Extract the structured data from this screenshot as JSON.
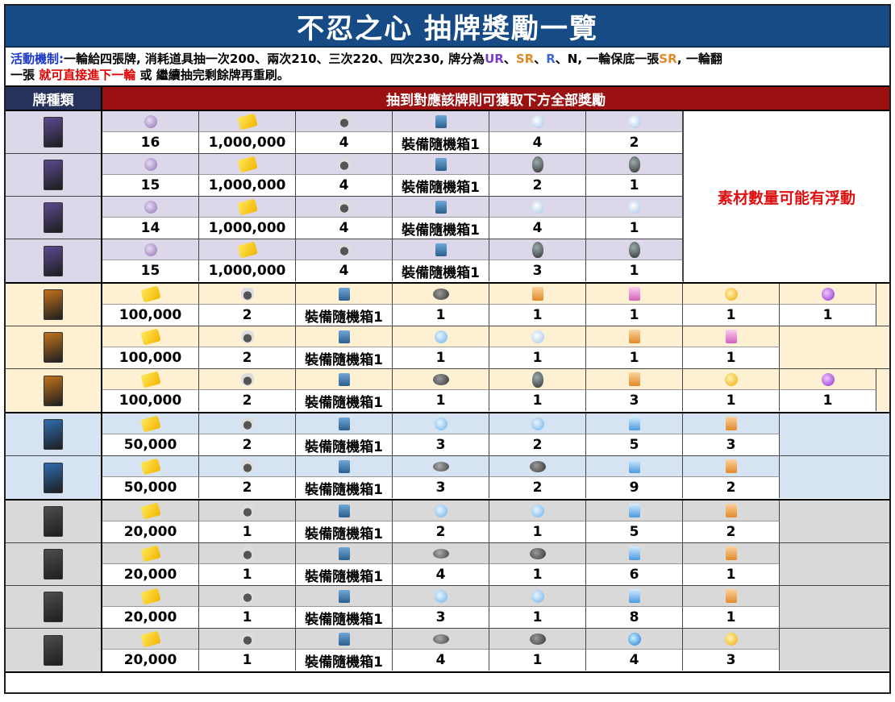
{
  "title": "不忍之心 抽牌獎勵一覽",
  "description": {
    "label": "活動機制:",
    "line1": "一輪給四張牌, 消耗道具抽一次200、兩次210、三次220、四次230, 牌分為",
    "ur": "UR",
    "sep1": "、",
    "sr": "SR",
    "sep2": "、",
    "r": "R",
    "line2": "、N, 一輪保底一張",
    "sr2": "SR",
    "line3": ", 一輪翻",
    "line4": "一張 ",
    "highlight": "就可直接進下一輪",
    "line5": " 或 繼續抽完剩餘牌再重刷。"
  },
  "header": {
    "left": "牌種類",
    "right": "抽到對應該牌則可獲取下方全部獎勵"
  },
  "side_note": "素材數量可能有浮動",
  "colors": {
    "ur_bg": "#ddd7ea",
    "sr_bg": "#fdf0d3",
    "r_bg": "#d6e3f2",
    "n_bg": "#d9d9d9"
  },
  "groups": [
    {
      "tier": "UR",
      "rows": [
        {
          "card": "UR-1",
          "icons": [
            "gem-icon",
            "money-icon",
            "coffee-icon",
            "box-icon",
            "crystal-icon",
            "crystal-icon"
          ],
          "values": [
            "16",
            "1,000,000",
            "4",
            "裝備隨機箱1",
            "4",
            "2"
          ]
        },
        {
          "card": "UR-2",
          "icons": [
            "gem-icon",
            "money-icon",
            "coffee-icon",
            "box-icon",
            "stone-icon",
            "stone-icon"
          ],
          "values": [
            "15",
            "1,000,000",
            "4",
            "裝備隨機箱1",
            "2",
            "1"
          ]
        },
        {
          "card": "UR-3",
          "icons": [
            "gem-icon",
            "money-icon",
            "coffee-icon",
            "box-icon",
            "crystal-icon",
            "crystal-icon"
          ],
          "values": [
            "14",
            "1,000,000",
            "4",
            "裝備隨機箱1",
            "4",
            "1"
          ]
        },
        {
          "card": "UR-4",
          "icons": [
            "gem-icon",
            "money-icon",
            "coffee-icon",
            "box-icon",
            "stone-icon",
            "stone-icon"
          ],
          "values": [
            "15",
            "1,000,000",
            "4",
            "裝備隨機箱1",
            "3",
            "1"
          ]
        }
      ]
    },
    {
      "tier": "SR",
      "rows": [
        {
          "card": "SR-1",
          "icons": [
            "money-icon",
            "coffee-icon",
            "box-icon",
            "fish-icon",
            "note-icon",
            "pnote-icon",
            "gold-icon",
            "purple-icon"
          ],
          "values": [
            "100,000",
            "2",
            "裝備隨機箱1",
            "1",
            "1",
            "1",
            "1",
            "1"
          ]
        },
        {
          "card": "SR-2",
          "icons": [
            "money-icon",
            "coffee-icon",
            "box-icon",
            "drop-icon",
            "crystal-icon",
            "note-icon",
            "pnote-icon"
          ],
          "values": [
            "100,000",
            "2",
            "裝備隨機箱1",
            "1",
            "1",
            "1",
            "1"
          ]
        },
        {
          "card": "SR-3",
          "icons": [
            "money-icon",
            "coffee-icon",
            "box-icon",
            "fish-icon",
            "stone-icon",
            "note-icon",
            "gold-icon",
            "purple-icon"
          ],
          "values": [
            "100,000",
            "2",
            "裝備隨機箱1",
            "1",
            "1",
            "3",
            "1",
            "1"
          ]
        }
      ]
    },
    {
      "tier": "R",
      "rows": [
        {
          "card": "R-1",
          "icons": [
            "money-icon",
            "coffee-icon",
            "box-icon",
            "drop-icon",
            "drop-icon",
            "bnote-icon",
            "note-icon"
          ],
          "values": [
            "50,000",
            "2",
            "裝備隨機箱1",
            "3",
            "2",
            "5",
            "3"
          ]
        },
        {
          "card": "R-2",
          "icons": [
            "money-icon",
            "coffee-icon",
            "box-icon",
            "ore-icon",
            "fish-icon",
            "bnote-icon",
            "note-icon"
          ],
          "values": [
            "50,000",
            "2",
            "裝備隨機箱1",
            "3",
            "2",
            "9",
            "2"
          ]
        }
      ]
    },
    {
      "tier": "N",
      "rows": [
        {
          "card": "N-1",
          "icons": [
            "money-icon",
            "coffee-icon",
            "box-icon",
            "drop-icon",
            "drop-icon",
            "bnote-icon",
            "note-icon"
          ],
          "values": [
            "20,000",
            "1",
            "裝備隨機箱1",
            "2",
            "1",
            "5",
            "2"
          ]
        },
        {
          "card": "N-2",
          "icons": [
            "money-icon",
            "coffee-icon",
            "box-icon",
            "ore-icon",
            "fish-icon",
            "bnote-icon",
            "note-icon"
          ],
          "values": [
            "20,000",
            "1",
            "裝備隨機箱1",
            "4",
            "1",
            "6",
            "1"
          ]
        },
        {
          "card": "N-3",
          "icons": [
            "money-icon",
            "coffee-icon",
            "box-icon",
            "drop-icon",
            "drop-icon",
            "bnote-icon",
            "note-icon"
          ],
          "values": [
            "20,000",
            "1",
            "裝備隨機箱1",
            "3",
            "1",
            "8",
            "1"
          ]
        },
        {
          "card": "N-4",
          "icons": [
            "money-icon",
            "coffee-icon",
            "box-icon",
            "ore-icon",
            "fish-icon",
            "bluejewel-icon",
            "gold-icon"
          ],
          "values": [
            "20,000",
            "1",
            "裝備隨機箱1",
            "4",
            "1",
            "4",
            "3"
          ]
        }
      ]
    }
  ]
}
